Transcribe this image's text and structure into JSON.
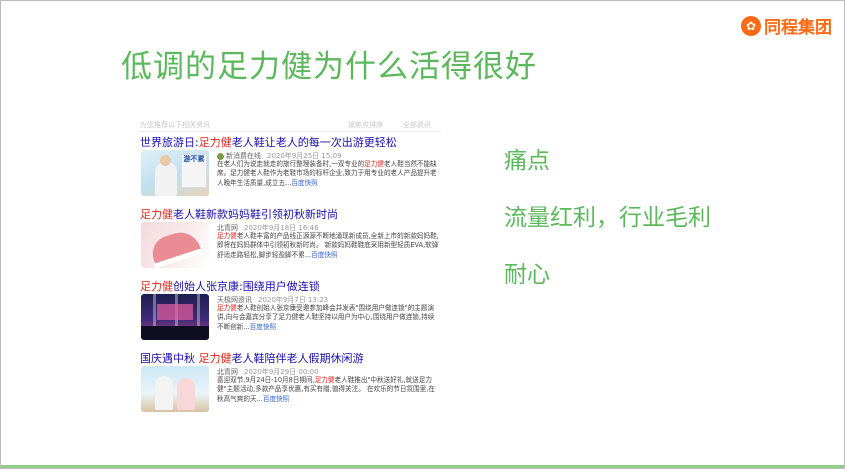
{
  "slide": {
    "title": "低调的足力健为什么活得很好"
  },
  "logo": {
    "text": "同程集团",
    "icon": "tongcheng-logo-icon",
    "color": "#ff6a13"
  },
  "points": [
    "痛点",
    "流量红利，行业毛利",
    "耐心"
  ],
  "news_crop": {
    "header_left": "为您推荐以下相关资讯",
    "header_right_1": "按焦点排序",
    "header_right_2": "全部资讯"
  },
  "news": [
    {
      "title_pre": "世界旅游日:",
      "title_hl": "足力健",
      "title_post": "老人鞋让老人的每一次出游更轻松",
      "source": "新消费在线",
      "date": "2020年9月25日 15:09",
      "desc_pre": "在老人们为说走就走的旅行整理装备时,一双专业的",
      "desc_hl": "足力健",
      "desc_post": "老人鞋当然不能缺席。足力健老人鞋作为老鞋市场的标杆企业,致力于用专业的老人产品提升老人晚年生活质量,成立五...",
      "more": "百度快照",
      "thumb_text": "游不累"
    },
    {
      "title_pre": "",
      "title_hl": "足力健",
      "title_post": "老人鞋新款妈妈鞋引领初秋新时尚",
      "source": "北青网",
      "date": "2020年9月18日 16:46",
      "desc_pre": "",
      "desc_hl": "足力健",
      "desc_post": "老人鞋丰富的产品线正源源不断地涌现新成员,全新上市的新款妈妈鞋,即将在妈妈群体中引领初秋新时尚。 新款妈妈鞋鞋底采用新型轻质EVA,软弹舒适走路轻松,脚步轻盈脚不累...",
      "more": "百度快照",
      "thumb_text": ""
    },
    {
      "title_pre": "",
      "title_hl": "足力健",
      "title_post": "创始人张京康:围绕用户做连锁",
      "source": "天极网资讯",
      "date": "2020年9月7日 13:23",
      "desc_pre": "",
      "desc_hl": "足力健",
      "desc_post": "老人鞋创始人张京康受邀参加峰会并发表\"围绕用户做连锁\"的主题演讲,向与会嘉宾分享了足力健老人鞋坚持以用户为中心,围绕用户做连锁,持续不断创新...",
      "more": "百度快照",
      "thumb_text": ""
    },
    {
      "title_pre": "国庆遇中秋 ",
      "title_hl": "足力健",
      "title_post": "老人鞋陪伴老人假期休闲游",
      "source": "北青网",
      "date": "2020年9月29日 00:00",
      "desc_pre": "喜迎双节,9月24日-10月8日期间,",
      "desc_hl": "足力健",
      "desc_post": "老人鞋推出\"中秋送好礼,就送足力健\"主题活动,多款产品享优惠,有买有赠,值得关注。 在欢乐的节日氛围里,在秋高气爽的天...",
      "more": "百度快照",
      "thumb_text": ""
    }
  ]
}
